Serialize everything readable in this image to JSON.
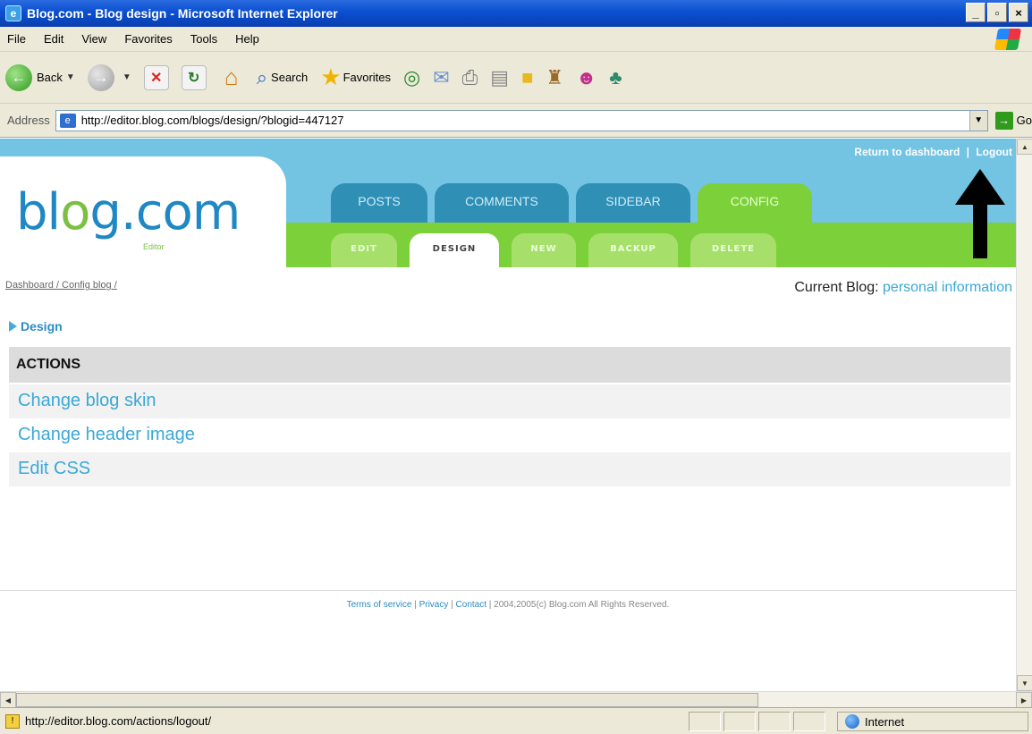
{
  "window": {
    "title": "Blog.com - Blog design - Microsoft Internet Explorer",
    "buttons": {
      "minimize": "_",
      "maximize": "▫",
      "close": "×"
    }
  },
  "menu": [
    "File",
    "Edit",
    "View",
    "Favorites",
    "Tools",
    "Help"
  ],
  "toolbar": {
    "back": "Back",
    "search": "Search",
    "favorites": "Favorites"
  },
  "address": {
    "label": "Address",
    "url": "http://editor.blog.com/blogs/design/?blogid=447127",
    "go": "Go"
  },
  "blog": {
    "toplinks": {
      "dashboard": "Return to dashboard",
      "separator": "|",
      "logout": "Logout"
    },
    "logo": {
      "text_a": "bl",
      "text_dot": "o",
      "text_b": "g.com",
      "sub": "Editor"
    },
    "main_tabs": [
      {
        "label": "POSTS",
        "active": false
      },
      {
        "label": "COMMENTS",
        "active": false
      },
      {
        "label": "SIDEBAR",
        "active": false
      },
      {
        "label": "CONFIG",
        "active": true
      }
    ],
    "sub_tabs": [
      {
        "label": "EDIT",
        "active": false
      },
      {
        "label": "DESIGN",
        "active": true
      },
      {
        "label": "NEW",
        "active": false
      },
      {
        "label": "BACKUP",
        "active": false
      },
      {
        "label": "DELETE",
        "active": false
      }
    ],
    "breadcrumb": {
      "dashboard": "Dashboard",
      "config": "Config blog",
      "sep": "/"
    },
    "current_blog": {
      "label": "Current Blog:",
      "name": "personal information"
    },
    "section_title": "Design",
    "actions": {
      "heading": "ACTIONS",
      "items": [
        "Change blog skin",
        "Change header image",
        "Edit CSS"
      ]
    },
    "footer": {
      "terms": "Terms of service",
      "privacy": "Privacy",
      "contact": "Contact",
      "sep": "|",
      "copyright": "2004,2005(c) Blog.com All Rights Reserved."
    }
  },
  "status": {
    "text": "http://editor.blog.com/actions/logout/",
    "zone": "Internet"
  },
  "colors": {
    "header_blue": "#73c3e2",
    "tab_blue": "#2f8fb5",
    "tab_green": "#7cd13a",
    "link_blue": "#3aa8d8",
    "ie_titlebar": "#0a4fd0"
  }
}
